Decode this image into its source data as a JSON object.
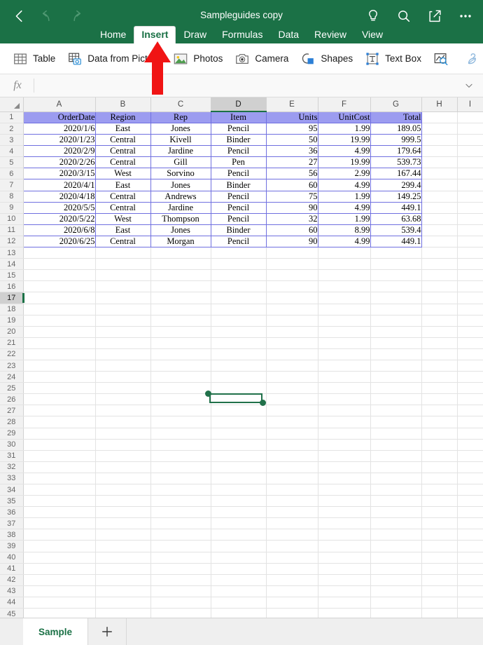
{
  "titlebar": {
    "back_icon": "back-chevron-icon",
    "undo_icon": "undo-icon",
    "redo_icon": "redo-icon",
    "document_title": "Sampleguides copy",
    "tellme_icon": "lightbulb-icon",
    "search_icon": "search-icon",
    "share_icon": "share-icon",
    "more_icon": "ellipsis-icon",
    "accent_color": "#1b7146"
  },
  "tabs": [
    {
      "label": "Home",
      "active": false
    },
    {
      "label": "Insert",
      "active": true
    },
    {
      "label": "Draw",
      "active": false
    },
    {
      "label": "Formulas",
      "active": false
    },
    {
      "label": "Data",
      "active": false
    },
    {
      "label": "Review",
      "active": false
    },
    {
      "label": "View",
      "active": false
    }
  ],
  "ribbon": {
    "items": [
      {
        "label": "Table",
        "icon": "table-icon"
      },
      {
        "label": "Data from Picture",
        "icon": "data-from-picture-icon"
      },
      {
        "label": "Photos",
        "icon": "photos-icon"
      },
      {
        "label": "Camera",
        "icon": "camera-icon"
      },
      {
        "label": "Shapes",
        "icon": "shapes-icon"
      },
      {
        "label": "Text Box",
        "icon": "text-box-icon"
      },
      {
        "label": "",
        "icon": "recommended-charts-icon"
      },
      {
        "label": "",
        "icon": "smart-lookup-icon"
      }
    ]
  },
  "formula_bar": {
    "fx_label": "fx",
    "value": "",
    "placeholder": "",
    "expand_icon": "chevron-down-icon"
  },
  "grid": {
    "columns": [
      "A",
      "B",
      "C",
      "D",
      "E",
      "F",
      "G",
      "H",
      "I"
    ],
    "selected_column": "D",
    "selected_row": 17,
    "total_rows": 47,
    "header_fill": "#9c9cf0",
    "border_color": "#7070e0",
    "header_row": [
      "OrderDate",
      "Region",
      "Rep",
      "Item",
      "Units",
      "UnitCost",
      "Total"
    ],
    "rows": [
      [
        "2020/1/6",
        "East",
        "Jones",
        "Pencil",
        "95",
        "1.99",
        "189.05"
      ],
      [
        "2020/1/23",
        "Central",
        "Kivell",
        "Binder",
        "50",
        "19.99",
        "999.5"
      ],
      [
        "2020/2/9",
        "Central",
        "Jardine",
        "Pencil",
        "36",
        "4.99",
        "179.64"
      ],
      [
        "2020/2/26",
        "Central",
        "Gill",
        "Pen",
        "27",
        "19.99",
        "539.73"
      ],
      [
        "2020/3/15",
        "West",
        "Sorvino",
        "Pencil",
        "56",
        "2.99",
        "167.44"
      ],
      [
        "2020/4/1",
        "East",
        "Jones",
        "Binder",
        "60",
        "4.99",
        "299.4"
      ],
      [
        "2020/4/18",
        "Central",
        "Andrews",
        "Pencil",
        "75",
        "1.99",
        "149.25"
      ],
      [
        "2020/5/5",
        "Central",
        "Jardine",
        "Pencil",
        "90",
        "4.99",
        "449.1"
      ],
      [
        "2020/5/22",
        "West",
        "Thompson",
        "Pencil",
        "32",
        "1.99",
        "63.68"
      ],
      [
        "2020/6/8",
        "East",
        "Jones",
        "Binder",
        "60",
        "8.99",
        "539.4"
      ],
      [
        "2020/6/25",
        "Central",
        "Morgan",
        "Pencil",
        "90",
        "4.99",
        "449.1"
      ]
    ]
  },
  "shape_object": {
    "name": "drawn-line-shape",
    "stroke_color": "#21714a",
    "handle_start": "start-handle",
    "handle_end": "end-handle"
  },
  "annotation": {
    "arrow_color": "#f01414",
    "points_to": "Insert"
  },
  "sheetbar": {
    "tabs": [
      {
        "label": "Sample",
        "active": true
      }
    ],
    "add_label": "+"
  }
}
